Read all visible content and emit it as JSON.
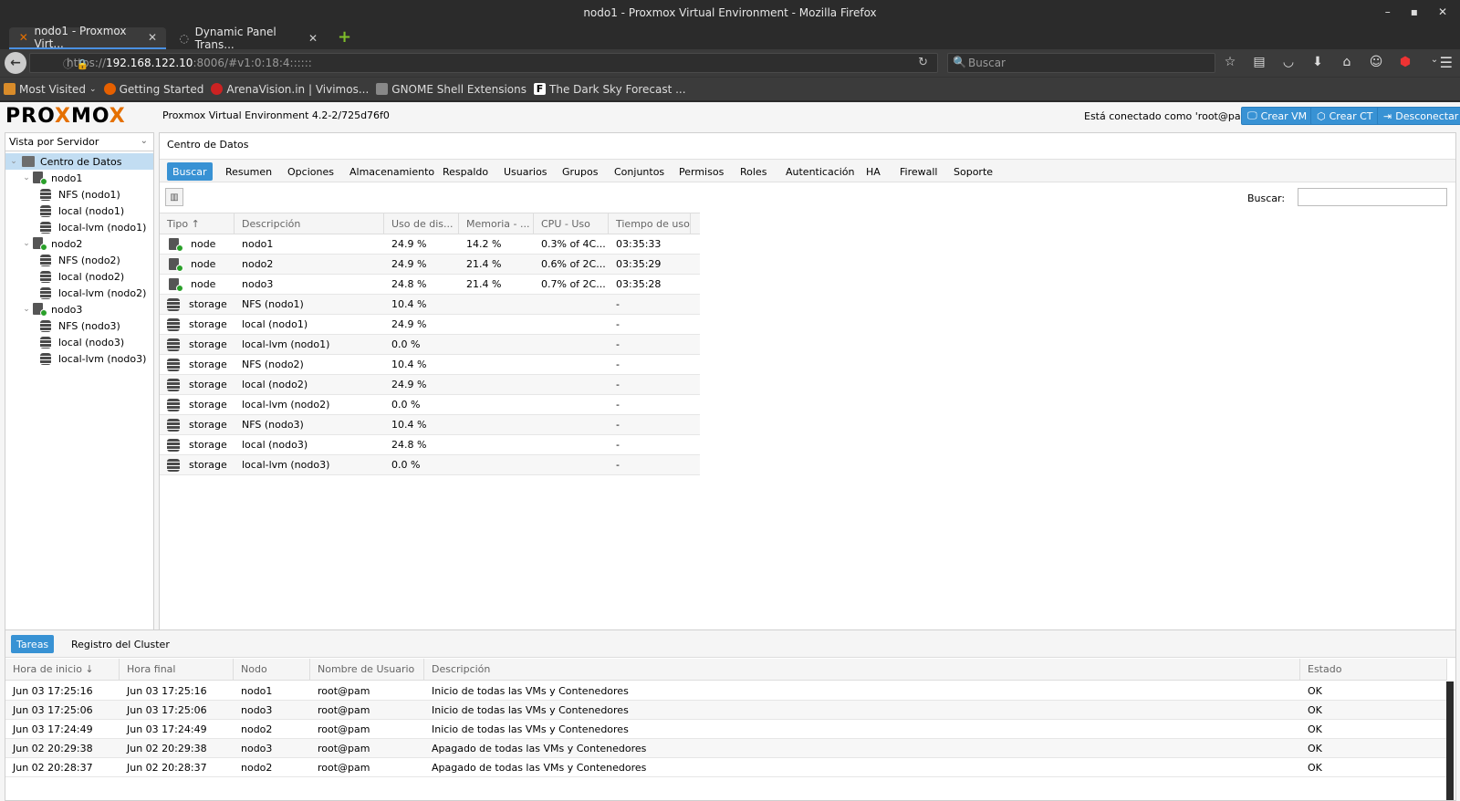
{
  "window": {
    "title": "nodo1 - Proxmox Virtual Environment - Mozilla Firefox"
  },
  "browser": {
    "tabs": [
      {
        "label": "nodo1 - Proxmox Virt...",
        "active": true
      },
      {
        "label": "Dynamic Panel Trans...",
        "active": false
      }
    ],
    "url": {
      "prefix": "https://",
      "host": "192.168.122.10",
      "rest": ":8006/#v1:0:18:4::::::"
    },
    "search_placeholder": "Buscar",
    "bookmarks": [
      "Most Visited",
      "Getting Started",
      "ArenaVision.in | Vivimos...",
      "GNOME Shell Extensions",
      "The Dark Sky Forecast ..."
    ]
  },
  "header": {
    "logo": {
      "a": "PRO",
      "x1": "X",
      "b": "MO",
      "x2": "X"
    },
    "version": "Proxmox Virtual Environment 4.2-2/725d76f0",
    "user_text": "Está conectado como 'root@pam'",
    "buttons": {
      "create_vm": "Crear VM",
      "create_ct": "Crear CT",
      "logout": "Desconectar"
    }
  },
  "sidebar": {
    "view_selector": "Vista por Servidor",
    "tree": [
      {
        "label": "Centro de Datos",
        "type": "datacenter",
        "level": 0,
        "expanded": true,
        "selected": true
      },
      {
        "label": "nodo1",
        "type": "node",
        "level": 1,
        "expanded": true
      },
      {
        "label": "NFS (nodo1)",
        "type": "storage",
        "level": 2
      },
      {
        "label": "local (nodo1)",
        "type": "storage",
        "level": 2
      },
      {
        "label": "local-lvm (nodo1)",
        "type": "storage",
        "level": 2
      },
      {
        "label": "nodo2",
        "type": "node",
        "level": 1,
        "expanded": true
      },
      {
        "label": "NFS (nodo2)",
        "type": "storage",
        "level": 2
      },
      {
        "label": "local (nodo2)",
        "type": "storage",
        "level": 2
      },
      {
        "label": "local-lvm (nodo2)",
        "type": "storage",
        "level": 2
      },
      {
        "label": "nodo3",
        "type": "node",
        "level": 1,
        "expanded": true
      },
      {
        "label": "NFS (nodo3)",
        "type": "storage",
        "level": 2
      },
      {
        "label": "local (nodo3)",
        "type": "storage",
        "level": 2
      },
      {
        "label": "local-lvm (nodo3)",
        "type": "storage",
        "level": 2
      }
    ]
  },
  "main": {
    "title": "Centro de Datos",
    "tabs": [
      "Buscar",
      "Resumen",
      "Opciones",
      "Almacenamiento",
      "Respaldo",
      "Usuarios",
      "Grupos",
      "Conjuntos",
      "Permisos",
      "Roles",
      "Autenticación",
      "HA",
      "Firewall",
      "Soporte"
    ],
    "active_tab": "Buscar",
    "search_label": "Buscar:",
    "columns": [
      "Tipo ↑",
      "Descripción",
      "Uso de dis...",
      "Memoria - ...",
      "CPU - Uso",
      "Tiempo de uso"
    ],
    "rows": [
      {
        "type": "node",
        "description": "nodo1",
        "disk": "24.9 %",
        "memory": "14.2 %",
        "cpu": "0.3% of 4C...",
        "uptime": "03:35:33"
      },
      {
        "type": "node",
        "description": "nodo2",
        "disk": "24.9 %",
        "memory": "21.4 %",
        "cpu": "0.6% of 2C...",
        "uptime": "03:35:29"
      },
      {
        "type": "node",
        "description": "nodo3",
        "disk": "24.8 %",
        "memory": "21.4 %",
        "cpu": "0.7% of 2C...",
        "uptime": "03:35:28"
      },
      {
        "type": "storage",
        "description": "NFS (nodo1)",
        "disk": "10.4 %",
        "memory": "",
        "cpu": "",
        "uptime": "-"
      },
      {
        "type": "storage",
        "description": "local (nodo1)",
        "disk": "24.9 %",
        "memory": "",
        "cpu": "",
        "uptime": "-"
      },
      {
        "type": "storage",
        "description": "local-lvm (nodo1)",
        "disk": "0.0 %",
        "memory": "",
        "cpu": "",
        "uptime": "-"
      },
      {
        "type": "storage",
        "description": "NFS (nodo2)",
        "disk": "10.4 %",
        "memory": "",
        "cpu": "",
        "uptime": "-"
      },
      {
        "type": "storage",
        "description": "local (nodo2)",
        "disk": "24.9 %",
        "memory": "",
        "cpu": "",
        "uptime": "-"
      },
      {
        "type": "storage",
        "description": "local-lvm (nodo2)",
        "disk": "0.0 %",
        "memory": "",
        "cpu": "",
        "uptime": "-"
      },
      {
        "type": "storage",
        "description": "NFS (nodo3)",
        "disk": "10.4 %",
        "memory": "",
        "cpu": "",
        "uptime": "-"
      },
      {
        "type": "storage",
        "description": "local (nodo3)",
        "disk": "24.8 %",
        "memory": "",
        "cpu": "",
        "uptime": "-"
      },
      {
        "type": "storage",
        "description": "local-lvm (nodo3)",
        "disk": "0.0 %",
        "memory": "",
        "cpu": "",
        "uptime": "-"
      }
    ]
  },
  "tasks": {
    "tabs": [
      "Tareas",
      "Registro del Cluster"
    ],
    "active_tab": "Tareas",
    "columns": [
      "Hora de inicio ↓",
      "Hora final",
      "Nodo",
      "Nombre de Usuario",
      "Descripción",
      "Estado"
    ],
    "rows": [
      {
        "start": "Jun 03 17:25:16",
        "end": "Jun 03 17:25:16",
        "node": "nodo1",
        "user": "root@pam",
        "description": "Inicio de todas las VMs y Contenedores",
        "status": "OK"
      },
      {
        "start": "Jun 03 17:25:06",
        "end": "Jun 03 17:25:06",
        "node": "nodo3",
        "user": "root@pam",
        "description": "Inicio de todas las VMs y Contenedores",
        "status": "OK"
      },
      {
        "start": "Jun 03 17:24:49",
        "end": "Jun 03 17:24:49",
        "node": "nodo2",
        "user": "root@pam",
        "description": "Inicio de todas las VMs y Contenedores",
        "status": "OK"
      },
      {
        "start": "Jun 02 20:29:38",
        "end": "Jun 02 20:29:38",
        "node": "nodo3",
        "user": "root@pam",
        "description": "Apagado de todas las VMs y Contenedores",
        "status": "OK"
      },
      {
        "start": "Jun 02 20:28:37",
        "end": "Jun 02 20:28:37",
        "node": "nodo2",
        "user": "root@pam",
        "description": "Apagado de todas las VMs y Contenedores",
        "status": "OK"
      }
    ]
  },
  "colors": {
    "accent": "#3892d4",
    "logo_x": "#e57000",
    "status_ok": "#2aa02a",
    "selection": "#c2ddf2"
  }
}
